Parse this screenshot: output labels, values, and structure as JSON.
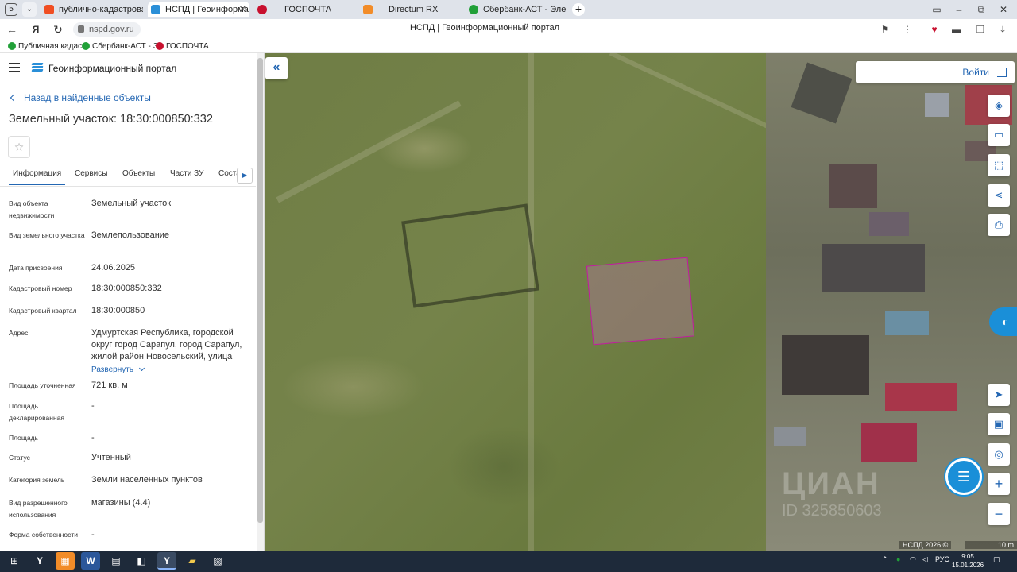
{
  "browser": {
    "tab_counter": "5",
    "tabs": [
      {
        "label": "публично-кадастровая к",
        "icon_color": "#f04e23"
      },
      {
        "label": "НСПД | Геоинформацио",
        "icon_color": "#2a8fd8",
        "active": true
      },
      {
        "label": "ГОСПОЧТА",
        "icon_color": "#c8102e"
      },
      {
        "label": "Directum RX",
        "icon_color": "#f28c28"
      },
      {
        "label": "Сбербанк-АСТ - Электро",
        "icon_color": "#21a038"
      }
    ],
    "url": "nspd.gov.ru",
    "page_title": "НСПД | Геоинформационный портал",
    "bookmarks": [
      {
        "label": "Публичная кадас",
        "icon_color": "#21a038"
      },
      {
        "label": "Сбербанк-АСТ - Э",
        "icon_color": "#21a038"
      },
      {
        "label": "ГОСПОЧТА",
        "icon_color": "#c8102e"
      }
    ]
  },
  "panel": {
    "app_title": "Геоинформационный портал",
    "back_link": "Назад в найденные объекты",
    "object_title": "Земельный участок: 18:30:000850:332",
    "tabs": [
      "Информация",
      "Сервисы",
      "Объекты",
      "Части ЗУ",
      "Соста"
    ],
    "fields": [
      {
        "label": "Вид объекта недвижимости",
        "value": "Земельный участок"
      },
      {
        "label": "Вид земельного участка",
        "value": "Землепользование"
      },
      {
        "label": "Дата присвоения",
        "value": "24.06.2025"
      },
      {
        "label": "Кадастровый номер",
        "value": "18:30:000850:332"
      },
      {
        "label": "Кадастровый квартал",
        "value": "18:30:000850"
      },
      {
        "label": "Адрес",
        "value": "Удмуртская Республика, городской округ город Сарапул, город Сарапул, жилой район Новосельский, улица"
      },
      {
        "label": "Площадь уточненная",
        "value": "721 кв. м"
      },
      {
        "label": "Площадь декларированная",
        "value": "-"
      },
      {
        "label": "Площадь",
        "value": "-"
      },
      {
        "label": "Статус",
        "value": "Учтенный"
      },
      {
        "label": "Категория земель",
        "value": "Земли населенных пунктов"
      },
      {
        "label": "Вид разрешенного использования",
        "value": "магазины (4.4)"
      },
      {
        "label": "Форма собственности",
        "value": "-"
      }
    ],
    "expand_link": "Развернуть"
  },
  "map": {
    "login_label": "Войти",
    "watermark": "ЦИАН",
    "watermark_id": "ID 325850603",
    "copyright": "НСПД 2026 ©",
    "scale": "10 m",
    "tools": [
      "layers-icon",
      "ruler-icon",
      "select-area-icon",
      "share-icon",
      "print-icon"
    ],
    "parcel_color": "#c21aa0"
  },
  "taskbar": {
    "language": "РУС",
    "time": "9:05",
    "date": "15.01.2026"
  }
}
